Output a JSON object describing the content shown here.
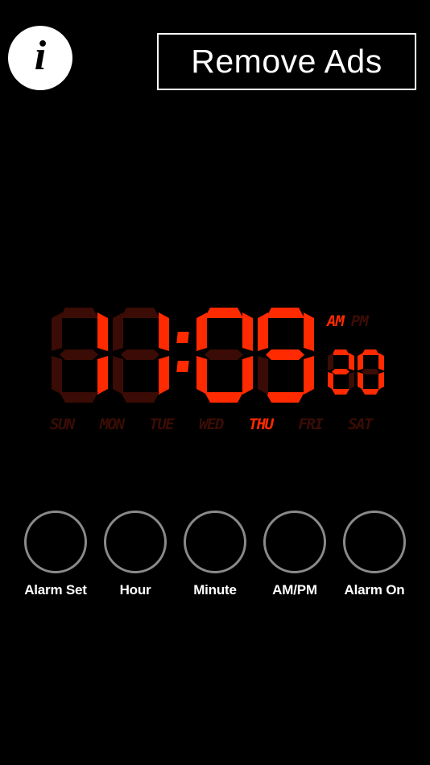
{
  "app": {
    "background_color": "#000000",
    "led_on_color": "#ff2a00",
    "led_off_color": "#3a0c05",
    "knob_stroke_color": "#8a8a8a",
    "accent_text_color": "#ffffff"
  },
  "topbar": {
    "info_button": {
      "icon": "info-italic-i-icon",
      "glyph": "i"
    },
    "remove_ads": {
      "label": "Remove Ads"
    }
  },
  "clock": {
    "time_text": "11:09",
    "hour_digits": [
      {
        "value": "1",
        "segments": [
          "b",
          "c"
        ]
      },
      {
        "value": "1",
        "segments": [
          "b",
          "c"
        ]
      }
    ],
    "separator": ":",
    "minute_digits": [
      {
        "value": "0",
        "segments": [
          "a",
          "b",
          "c",
          "d",
          "e",
          "f"
        ]
      },
      {
        "value": "9",
        "segments": [
          "a",
          "b",
          "c",
          "d",
          "f",
          "g"
        ]
      }
    ],
    "seconds_text": "20",
    "seconds_digits": [
      {
        "value": "2",
        "segments": [
          "a",
          "b",
          "g",
          "e",
          "d"
        ]
      },
      {
        "value": "0",
        "segments": [
          "a",
          "b",
          "c",
          "d",
          "e",
          "f"
        ]
      }
    ],
    "meridiem": {
      "active": "AM",
      "options": [
        {
          "label": "AM",
          "active": true
        },
        {
          "label": "PM",
          "active": false
        }
      ]
    },
    "days": [
      {
        "label": "SUN",
        "active": false
      },
      {
        "label": "MON",
        "active": false
      },
      {
        "label": "TUE",
        "active": false
      },
      {
        "label": "WED",
        "active": false
      },
      {
        "label": "THU",
        "active": true
      },
      {
        "label": "FRI",
        "active": false
      },
      {
        "label": "SAT",
        "active": false
      }
    ],
    "active_day": "THU"
  },
  "controls": [
    {
      "label": "Alarm Set",
      "name": "alarm-set"
    },
    {
      "label": "Hour",
      "name": "hour"
    },
    {
      "label": "Minute",
      "name": "minute"
    },
    {
      "label": "AM/PM",
      "name": "am-pm"
    },
    {
      "label": "Alarm On",
      "name": "alarm-on"
    }
  ]
}
